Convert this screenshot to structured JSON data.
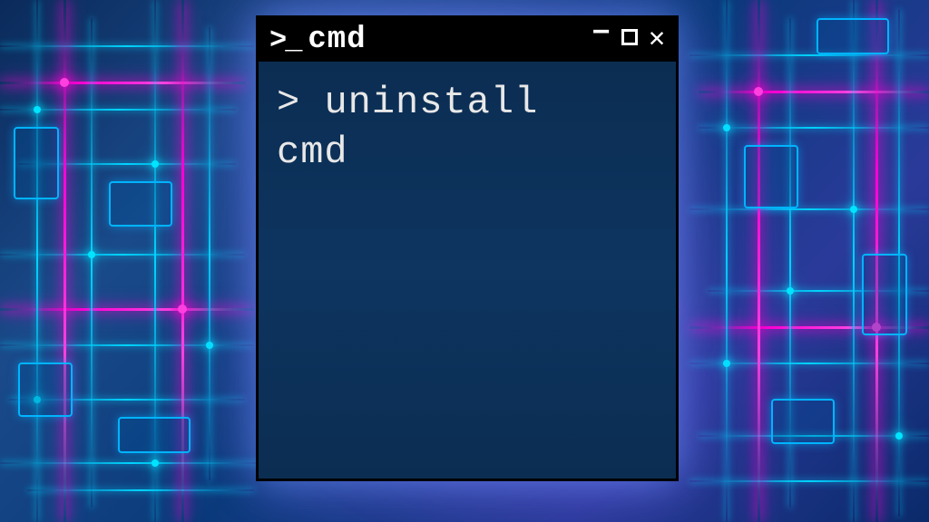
{
  "window": {
    "title": "cmd",
    "icon_text": ">_"
  },
  "terminal": {
    "prompt": ">",
    "command_line1": "uninstall",
    "command_line2": "cmd"
  },
  "controls": {
    "minimize": "−",
    "close": "✕"
  }
}
